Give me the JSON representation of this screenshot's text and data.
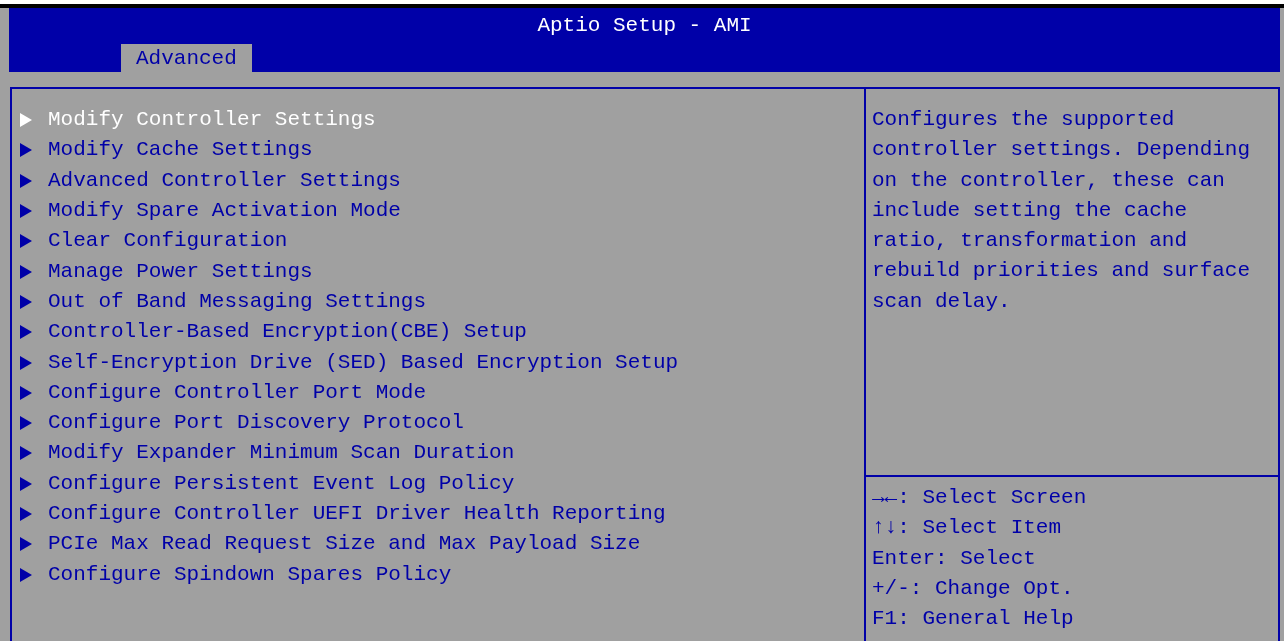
{
  "window": {
    "title": "Aptio Setup - AMI"
  },
  "tabs": [
    {
      "label": "Advanced",
      "selected": true
    }
  ],
  "menu_items": [
    {
      "label": "Modify Controller Settings",
      "selected": true
    },
    {
      "label": "Modify Cache Settings",
      "selected": false
    },
    {
      "label": "Advanced Controller Settings",
      "selected": false
    },
    {
      "label": "Modify Spare Activation Mode",
      "selected": false
    },
    {
      "label": "Clear Configuration",
      "selected": false
    },
    {
      "label": "Manage Power Settings",
      "selected": false
    },
    {
      "label": "Out of Band Messaging Settings",
      "selected": false
    },
    {
      "label": "Controller-Based Encryption(CBE) Setup",
      "selected": false
    },
    {
      "label": "Self-Encryption Drive (SED) Based Encryption Setup",
      "selected": false
    },
    {
      "label": "Configure Controller Port Mode",
      "selected": false
    },
    {
      "label": "Configure Port Discovery Protocol",
      "selected": false
    },
    {
      "label": "Modify Expander Minimum Scan Duration",
      "selected": false
    },
    {
      "label": "Configure Persistent Event Log Policy",
      "selected": false
    },
    {
      "label": "Configure Controller UEFI Driver Health Reporting",
      "selected": false
    },
    {
      "label": "PCIe Max Read Request Size and Max Payload Size",
      "selected": false
    },
    {
      "label": "Configure Spindown Spares Policy",
      "selected": false
    }
  ],
  "help_text": "Configures the supported controller settings. Depending on the controller, these can include setting the cache ratio, transformation and rebuild priorities and surface scan delay.",
  "key_help": [
    {
      "key": "→←",
      "action": ": Select Screen"
    },
    {
      "key": "↑↓",
      "action": ": Select Item"
    },
    {
      "key": "Enter",
      "action": ": Select"
    },
    {
      "key": "+/-",
      "action": ": Change Opt."
    },
    {
      "key": "F1",
      "action": ": General Help"
    }
  ]
}
